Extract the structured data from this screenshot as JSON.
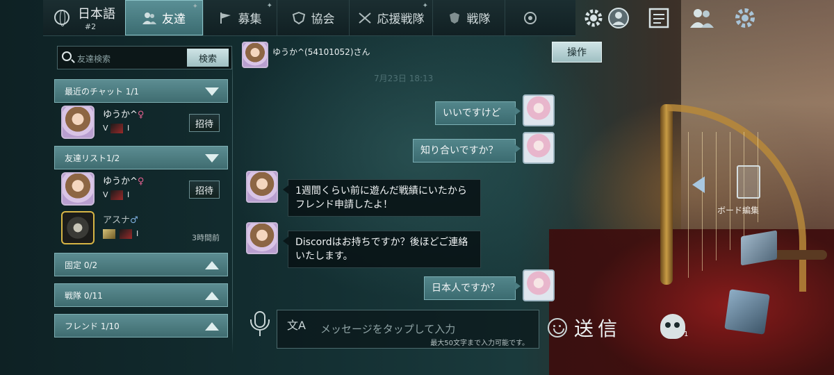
{
  "tabs": {
    "language": "日本語",
    "language_num": "#2",
    "friends": "友達",
    "recruit": "募集",
    "guild": "協会",
    "support": "応援戦隊",
    "team": "戦隊"
  },
  "search": {
    "placeholder": "友達検索",
    "button": "検索"
  },
  "sections": {
    "recent": "最近のチャット 1/1",
    "friend_list": "友達リスト1/2",
    "pinned": "固定 0/2",
    "team": "戦隊 0/11",
    "friend": "フレンド 1/10"
  },
  "recent_chat": [
    {
      "name": "ゆうか^",
      "gender": "♀",
      "rank": "V",
      "level": "I",
      "invite": "招待"
    }
  ],
  "friends": [
    {
      "name": "ゆうか^",
      "gender": "♀",
      "rank": "V",
      "level": "I",
      "invite": "招待",
      "last_seen": ""
    },
    {
      "name": "アスナ",
      "gender": "♂",
      "rank": "",
      "level": "I",
      "invite": "",
      "last_seen": "3時間前"
    }
  ],
  "chat": {
    "title": "ゆうか^(54101052)さん",
    "operate_button": "操作",
    "timestamp": "7月23日 18:13",
    "messages": [
      {
        "from": "me",
        "text": "いいですけど"
      },
      {
        "from": "me",
        "text": "知り合いですか？"
      },
      {
        "from": "them",
        "text": "1週間くらい前に遊んだ戦績にいたからフレンド申請したよ！"
      },
      {
        "from": "them",
        "text": "Discordはお持ちですか？後ほどご連絡いたします。"
      },
      {
        "from": "me",
        "text": "日本人ですか？"
      }
    ],
    "input_placeholder": "メッセージをタップして入力",
    "input_limit": "最大50文字まで入力可能です。",
    "send": "送信"
  },
  "right_hud": {
    "board_edit": "ボード編集",
    "skull_count": "1"
  },
  "colors": {
    "accent": "#4f8388",
    "panel_dark": "#0c1718",
    "female": "#e0608e",
    "male": "#7fb0e0"
  }
}
